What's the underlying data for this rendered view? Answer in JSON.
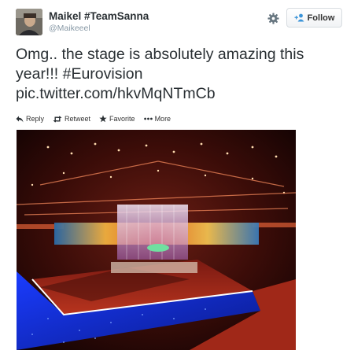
{
  "author": {
    "display_name": "Maikel #TeamSanna",
    "handle": "@Maikeeel"
  },
  "header": {
    "follow_label": "Follow",
    "settings_icon": "gear-icon",
    "follow_icon": "add-user-icon"
  },
  "tweet": {
    "text_line1": "Omg.. the stage is absolutely amazing this",
    "text_line2": "year!!! #Eurovision",
    "link": "pic.twitter.com/hkvMqNTmCb"
  },
  "actions": {
    "reply_label": "Reply",
    "retweet_label": "Retweet",
    "favorite_label": "Favorite",
    "more_label": "More"
  },
  "colors": {
    "text": "#292f33",
    "muted": "#8899a6",
    "link": "#292f33"
  }
}
